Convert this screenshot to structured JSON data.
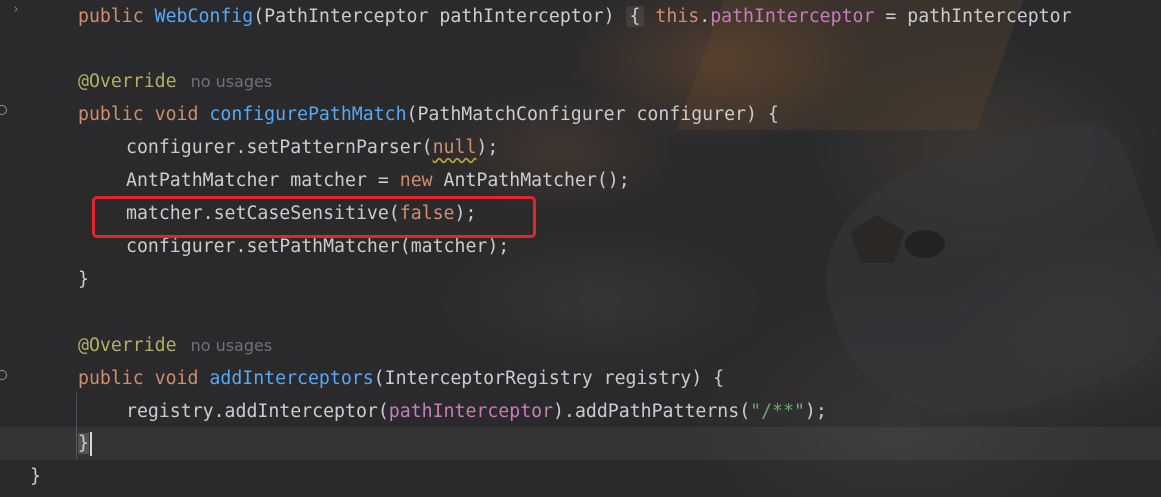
{
  "editor": {
    "lines": {
      "l1": {
        "kw": "public",
        "ctor": "WebConfig",
        "params": "(PathInterceptor pathInterceptor)",
        "fold": "{",
        "this": "this",
        "dot": ".",
        "field": "pathInterceptor",
        "rest": " = pathInterceptor"
      },
      "l2": {
        "annotation": "@Override",
        "hint": "no usages"
      },
      "l3": {
        "kw1": "public",
        "kw2": "void",
        "method": "configurePathMatch",
        "params": "(PathMatchConfigurer configurer) {"
      },
      "l4": {
        "pre": "configurer.setPatternParser(",
        "null": "null",
        "post": ");"
      },
      "l5": {
        "pre": "AntPathMatcher matcher = ",
        "new": "new",
        "post": " AntPathMatcher();"
      },
      "l6": {
        "pre": "matcher.setCaseSensitive(",
        "false": "false",
        "post": ");"
      },
      "l7": {
        "text": "configurer.setPathMatcher(matcher);"
      },
      "l8": {
        "text": "}"
      },
      "l9": {
        "annotation": "@Override",
        "hint": "no usages"
      },
      "l10": {
        "kw1": "public",
        "kw2": "void",
        "method": "addInterceptors",
        "params": "(InterceptorRegistry registry) {"
      },
      "l11": {
        "pre": "registry.addInterceptor(",
        "field": "pathInterceptor",
        "mid": ").addPathPatterns(",
        "str": "\"/**\"",
        "post": ");"
      },
      "l12": {
        "text": "}"
      },
      "l13": {
        "text": "}"
      }
    },
    "gutter": {
      "chevron": "›"
    }
  },
  "annotation_box": {
    "color": "#e5232a",
    "target": "matcher.setCaseSensitive(false);"
  },
  "colors": {
    "keyword": "#cf8e6d",
    "function": "#56a8f5",
    "field": "#c77dbb",
    "annotation": "#b3ae60",
    "string": "#6aab73",
    "text": "#c9ccd0"
  }
}
